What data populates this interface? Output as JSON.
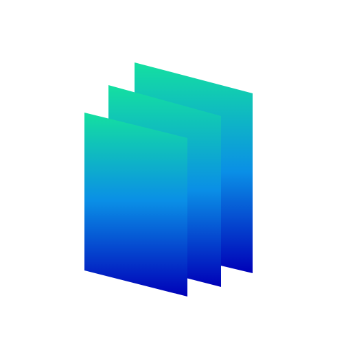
{
  "icon": {
    "name": "stacked-layers-icon",
    "layer_count": 3
  },
  "colors": {
    "background": "#ffffff",
    "gradient_top": "#14e0a0",
    "gradient_mid": "#0a8fe6",
    "gradient_bottom": "#0000b8"
  }
}
